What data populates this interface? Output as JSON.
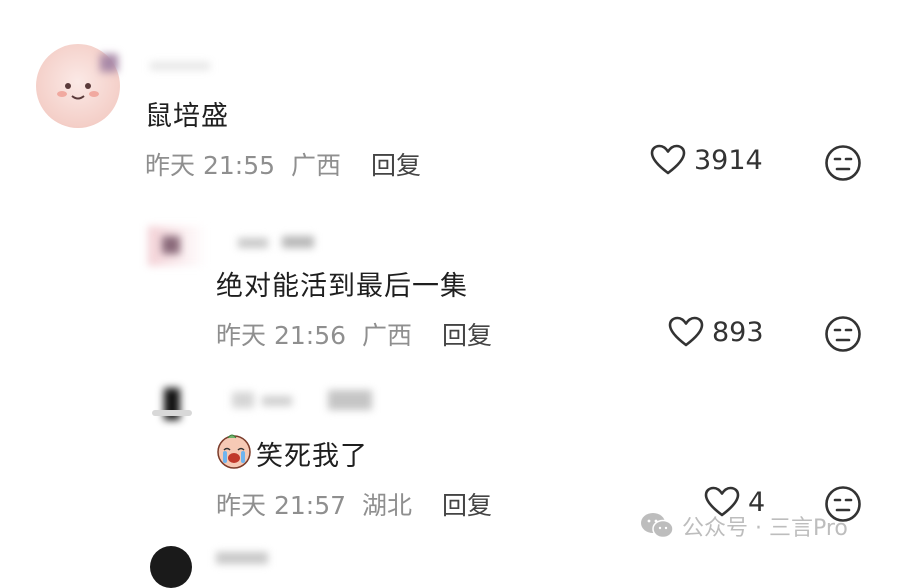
{
  "comments": [
    {
      "content": "鼠培盛",
      "date": "昨天",
      "time": "21:55",
      "location": "广西",
      "reply": "回复",
      "likes": "3914"
    },
    {
      "content": "绝对能活到最后一集",
      "date": "昨天",
      "time": "21:56",
      "location": "广西",
      "reply": "回复",
      "likes": "893"
    },
    {
      "content": "笑死我了",
      "date": "昨天",
      "time": "21:57",
      "location": "湖北",
      "reply": "回复",
      "likes": "4"
    }
  ],
  "watermark": {
    "text": "公众号 · 三言Pro",
    "icon": "wechat-icon"
  },
  "colors": {
    "meta": "#8f8f8f",
    "text": "#1f1f1f",
    "icon": "#333333"
  }
}
